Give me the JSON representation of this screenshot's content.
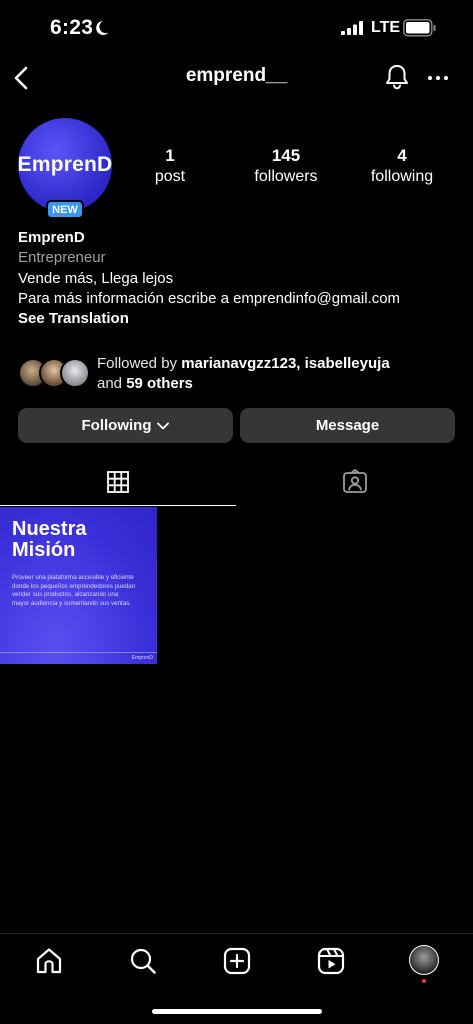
{
  "status_bar": {
    "time": "6:23",
    "network": "LTE",
    "icons": [
      "moon-icon",
      "signal-icon",
      "battery-icon"
    ]
  },
  "header": {
    "username": "emprend__",
    "icons": [
      "back-icon",
      "bell-icon",
      "more-icon"
    ]
  },
  "profile": {
    "avatar_text": "EmprenD",
    "badge": "NEW",
    "stats": {
      "posts_count": "1",
      "posts_label": "post",
      "followers_count": "145",
      "followers_label": "followers",
      "following_count": "4",
      "following_label": "following"
    },
    "bio": {
      "name": "EmprenD",
      "category": "Entrepreneur",
      "line1": "Vende más, Llega lejos",
      "line2": "Para más información escribe a emprendinfo@gmail.com",
      "translate": "See Translation"
    },
    "followed_by": {
      "prefix": "Followed by ",
      "users": "marianavgzz123, isabelleyuja",
      "and": "and ",
      "others": "59 others"
    }
  },
  "actions": {
    "following_label": "Following",
    "message_label": "Message"
  },
  "tabs": [
    "grid-icon",
    "tagged-icon"
  ],
  "posts": [
    {
      "title_line1": "Nuestra",
      "title_line2": "Misión",
      "body": "Proveer una plataforma accesible y eficiente donde los pequeños emprendedores puedan vender sus productos, alcanzando una mayor audiencia y sumentando sus ventas.",
      "brand": "EmprenD"
    }
  ],
  "bottom_nav": [
    "home-icon",
    "search-icon",
    "create-icon",
    "reels-icon",
    "profile-avatar"
  ],
  "colors": {
    "background": "#000000",
    "button": "#363636",
    "badge": "#3897f0",
    "brand": "#3a2fd8",
    "notification_dot": "#ff3040"
  }
}
